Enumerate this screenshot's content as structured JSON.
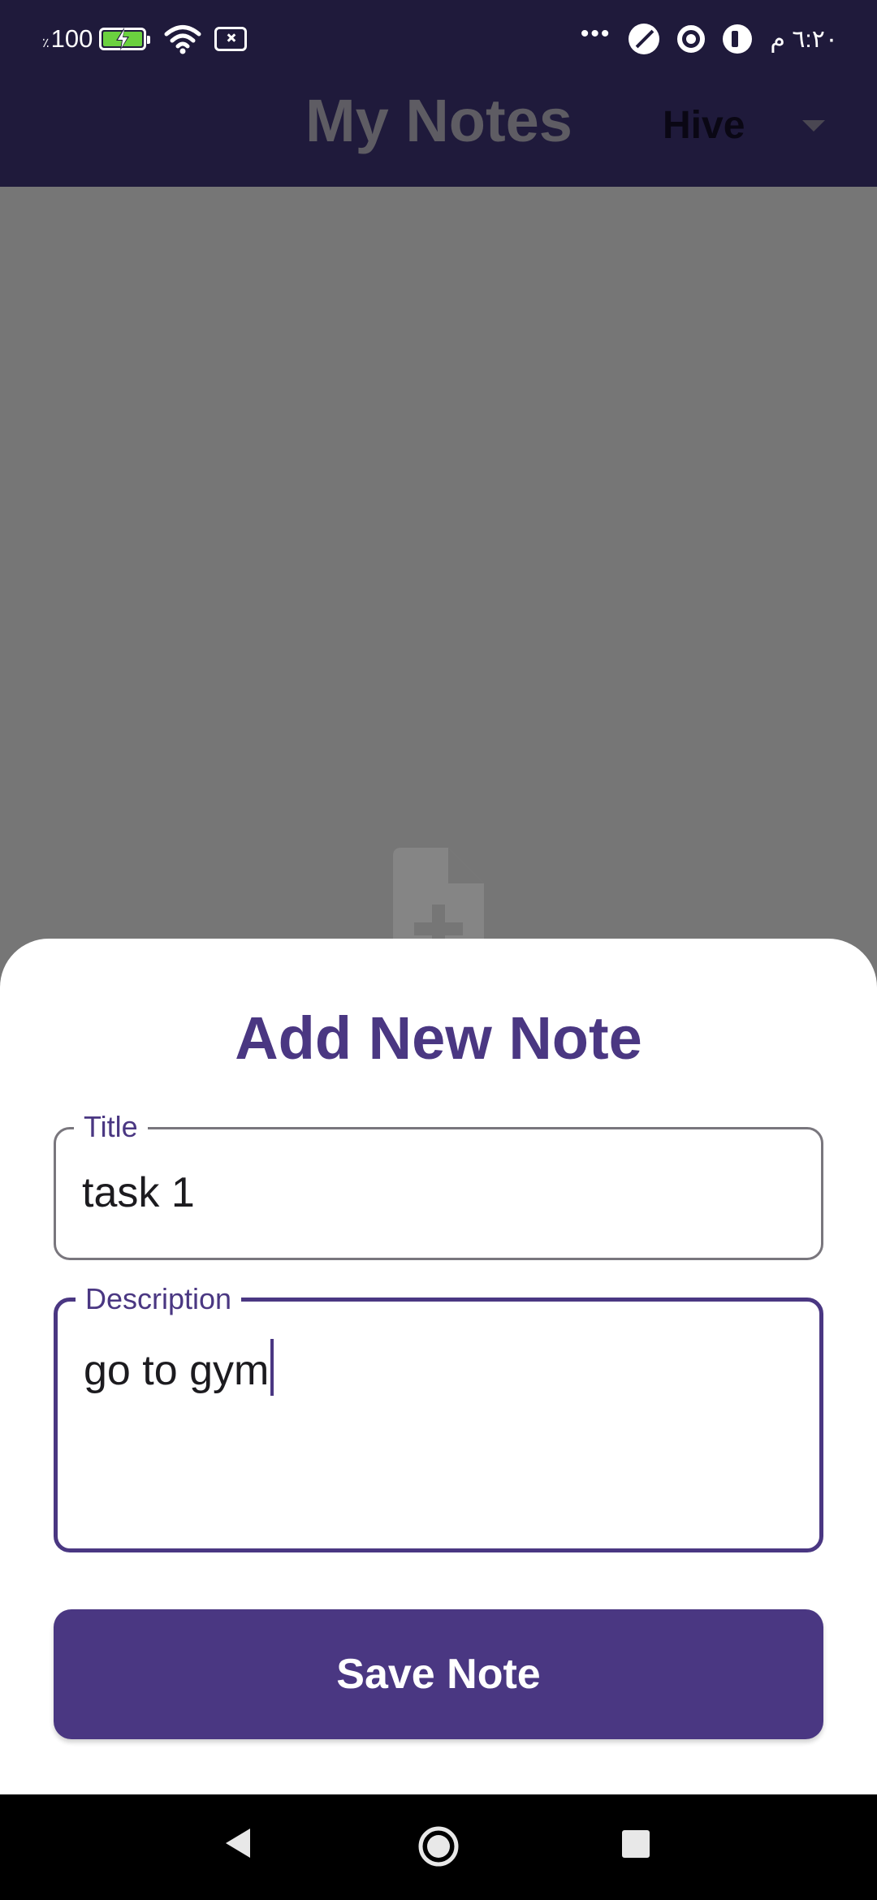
{
  "status_bar": {
    "battery_text": "100",
    "battery_percent_sign": "٪",
    "time": "٦:٢٠ م",
    "icons": [
      "battery-charging-icon",
      "wifi-icon",
      "no-sim-icon",
      "more-dots-icon",
      "blocked-icon",
      "chrome-icon",
      "app-notification-icon"
    ]
  },
  "app_bar": {
    "title": "My Notes",
    "db_select": {
      "selected": "Hive"
    }
  },
  "background": {
    "empty_icon": "note-add-icon"
  },
  "sheet": {
    "title": "Add New Note",
    "title_field": {
      "label": "Title",
      "value": "task 1"
    },
    "description_field": {
      "label": "Description",
      "value": "go to gym"
    },
    "save_label": "Save Note"
  },
  "nav_bar": {
    "icons": [
      "back-icon",
      "home-icon",
      "recents-icon"
    ]
  },
  "colors": {
    "primary": "#4A3782",
    "app_bar": "#1F1A3B",
    "scrim": "#767676"
  }
}
